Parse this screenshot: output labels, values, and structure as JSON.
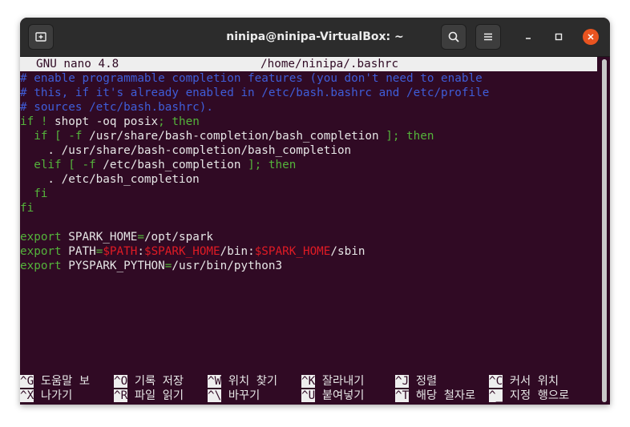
{
  "window": {
    "title": "ninipa@ninipa-VirtualBox: ~",
    "new_tab_icon": "new-tab-icon",
    "search_icon": "search-icon",
    "menu_icon": "hamburger-menu-icon",
    "minimize_icon": "minimize-icon",
    "maximize_icon": "maximize-icon",
    "close_icon": "close-icon"
  },
  "nano": {
    "version": "GNU nano 4.8",
    "file": "/home/ninipa/.bashrc"
  },
  "lines": [
    [
      {
        "t": "# enable programmable completion features (you don't need to enable",
        "c": "com"
      }
    ],
    [
      {
        "t": "# this, if it's already enabled in /etc/bash.bashrc and /etc/profile",
        "c": "com"
      }
    ],
    [
      {
        "t": "# sources /etc/bash.bashrc).",
        "c": "com"
      }
    ],
    [
      {
        "t": "if",
        "c": "kw"
      },
      {
        "t": " ",
        "c": ""
      },
      {
        "t": "!",
        "c": "kw"
      },
      {
        "t": " shopt -oq posix",
        "c": ""
      },
      {
        "t": "; then",
        "c": "kw"
      }
    ],
    [
      {
        "t": "  if",
        "c": "kw"
      },
      {
        "t": " ",
        "c": ""
      },
      {
        "t": "[",
        "c": "kw"
      },
      {
        "t": " ",
        "c": ""
      },
      {
        "t": "-f",
        "c": "kw"
      },
      {
        "t": " /usr/share/bash-completion/bash_completion ",
        "c": ""
      },
      {
        "t": "]; then",
        "c": "kw"
      }
    ],
    [
      {
        "t": "    . /usr/share/bash-completion/bash_completion",
        "c": ""
      }
    ],
    [
      {
        "t": "  elif",
        "c": "kw"
      },
      {
        "t": " ",
        "c": ""
      },
      {
        "t": "[",
        "c": "kw"
      },
      {
        "t": " ",
        "c": ""
      },
      {
        "t": "-f",
        "c": "kw"
      },
      {
        "t": " /etc/bash_completion ",
        "c": ""
      },
      {
        "t": "]; then",
        "c": "kw"
      }
    ],
    [
      {
        "t": "    . /etc/bash_completion",
        "c": ""
      }
    ],
    [
      {
        "t": "  fi",
        "c": "kw"
      }
    ],
    [
      {
        "t": "fi",
        "c": "kw"
      }
    ],
    [
      {
        "t": "",
        "c": ""
      }
    ],
    [
      {
        "t": "export",
        "c": "kw"
      },
      {
        "t": " SPARK_HOME",
        "c": ""
      },
      {
        "t": "=",
        "c": "kw"
      },
      {
        "t": "/opt/spark",
        "c": ""
      }
    ],
    [
      {
        "t": "export",
        "c": "kw"
      },
      {
        "t": " PATH",
        "c": ""
      },
      {
        "t": "=",
        "c": "kw"
      },
      {
        "t": "$PATH",
        "c": "var"
      },
      {
        "t": ":",
        "c": ""
      },
      {
        "t": "$SPARK_HOME",
        "c": "var"
      },
      {
        "t": "/bin:",
        "c": ""
      },
      {
        "t": "$SPARK_HOME",
        "c": "var"
      },
      {
        "t": "/sbin",
        "c": ""
      }
    ],
    [
      {
        "t": "export",
        "c": "kw"
      },
      {
        "t": " PYSPARK_PYTHON",
        "c": ""
      },
      {
        "t": "=",
        "c": "kw"
      },
      {
        "t": "/usr/bin/python3",
        "c": ""
      }
    ]
  ],
  "help": {
    "row1": [
      {
        "key": "^G",
        "label": " 도움말 보"
      },
      {
        "key": "^O",
        "label": " 기록 저장"
      },
      {
        "key": "^W",
        "label": " 위치 찾기"
      },
      {
        "key": "^K",
        "label": " 잘라내기"
      },
      {
        "key": "^J",
        "label": " 정렬"
      },
      {
        "key": "^C",
        "label": " 커서 위치"
      }
    ],
    "row2": [
      {
        "key": "^X",
        "label": " 나가기"
      },
      {
        "key": "^R",
        "label": " 파일 읽기"
      },
      {
        "key": "^\\",
        "label": " 바꾸기"
      },
      {
        "key": "^U",
        "label": " 붙여넣기"
      },
      {
        "key": "^T",
        "label": " 해당 철자로"
      },
      {
        "key": "^_",
        "label": " 지정 행으로"
      }
    ]
  }
}
